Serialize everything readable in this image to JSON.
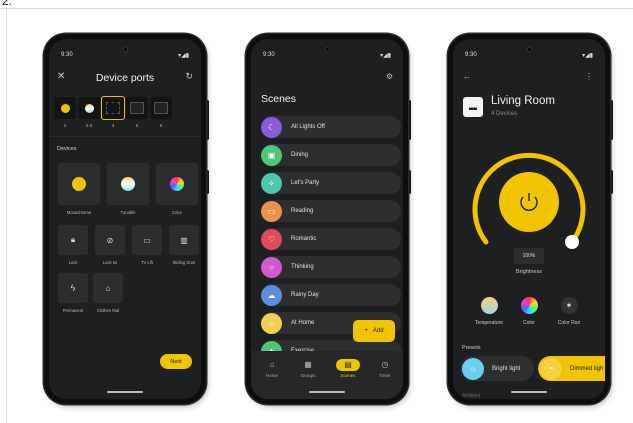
{
  "figure_label": "2.",
  "colors": {
    "accent": "#f0c400",
    "screen_bg": "#1e1f21",
    "card_bg": "#2b2c2e"
  },
  "phone1": {
    "time": "9:30",
    "status_icons": "▾◢▮",
    "title": "Device ports",
    "close_icon": "close-icon",
    "refresh_icon": "refresh-icon",
    "ports": [
      {
        "label": "1",
        "color": "#f0c400",
        "selected": false
      },
      {
        "label": "2-3",
        "color": "#ffffff",
        "selected": false
      },
      {
        "label": "4",
        "color": "",
        "selected": true
      },
      {
        "label": "5",
        "color": "",
        "selected": false
      },
      {
        "label": "6",
        "color": "",
        "selected": false
      }
    ],
    "section_title": "Devices",
    "devices_large": [
      "Monochrome",
      "Tunable",
      "Color"
    ],
    "devices_small_row1": [
      "Lock",
      "Lock 5s",
      "TV Lift",
      "Sliding Door"
    ],
    "devices_small_row2": [
      "Permanent",
      "Clothes Rail"
    ],
    "next_label": "Next"
  },
  "phone2": {
    "time": "9:30",
    "status_icons": "▾◢▮",
    "title": "Scenes",
    "scenes": [
      {
        "name": "All Lights Off",
        "color": "#8a5cd8",
        "icon": "moon-icon"
      },
      {
        "name": "Dining",
        "color": "#4cc77a",
        "icon": "dining-icon"
      },
      {
        "name": "Let's Party",
        "color": "#4cc7b0",
        "icon": "party-icon"
      },
      {
        "name": "Reading",
        "color": "#e8924a",
        "icon": "book-icon"
      },
      {
        "name": "Romantic",
        "color": "#e04a5a",
        "icon": "heart-icon"
      },
      {
        "name": "Thinking",
        "color": "#d05ad0",
        "icon": "thought-icon"
      },
      {
        "name": "Rainy Day",
        "color": "#5a8ee0",
        "icon": "cloud-icon"
      },
      {
        "name": "At Home",
        "color": "#f0d050",
        "icon": "home-icon"
      },
      {
        "name": "Exercise",
        "color": "#4cc77a",
        "icon": "run-icon"
      }
    ],
    "add_label": "Add",
    "nav": [
      "Home",
      "Groups",
      "Scenes",
      "Timer"
    ],
    "nav_active": "Scenes"
  },
  "phone3": {
    "time": "9:30",
    "status_icons": "▾◢▮",
    "room_name": "Living Room",
    "room_sub": "4 Devices",
    "brightness_value": "100%",
    "brightness_fraction": 1.0,
    "brightness_label": "Brightness",
    "controls": [
      "Temperature",
      "Color",
      "Color Run"
    ],
    "presets_label": "Presets",
    "presets": [
      {
        "name": "Bright light",
        "bg": "#2d2e30",
        "badge": "#6ad0f0"
      },
      {
        "name": "Dimmed ligh",
        "bg": "#f0c400",
        "badge": "#f5d040"
      }
    ],
    "cut_label": "Ambient"
  }
}
